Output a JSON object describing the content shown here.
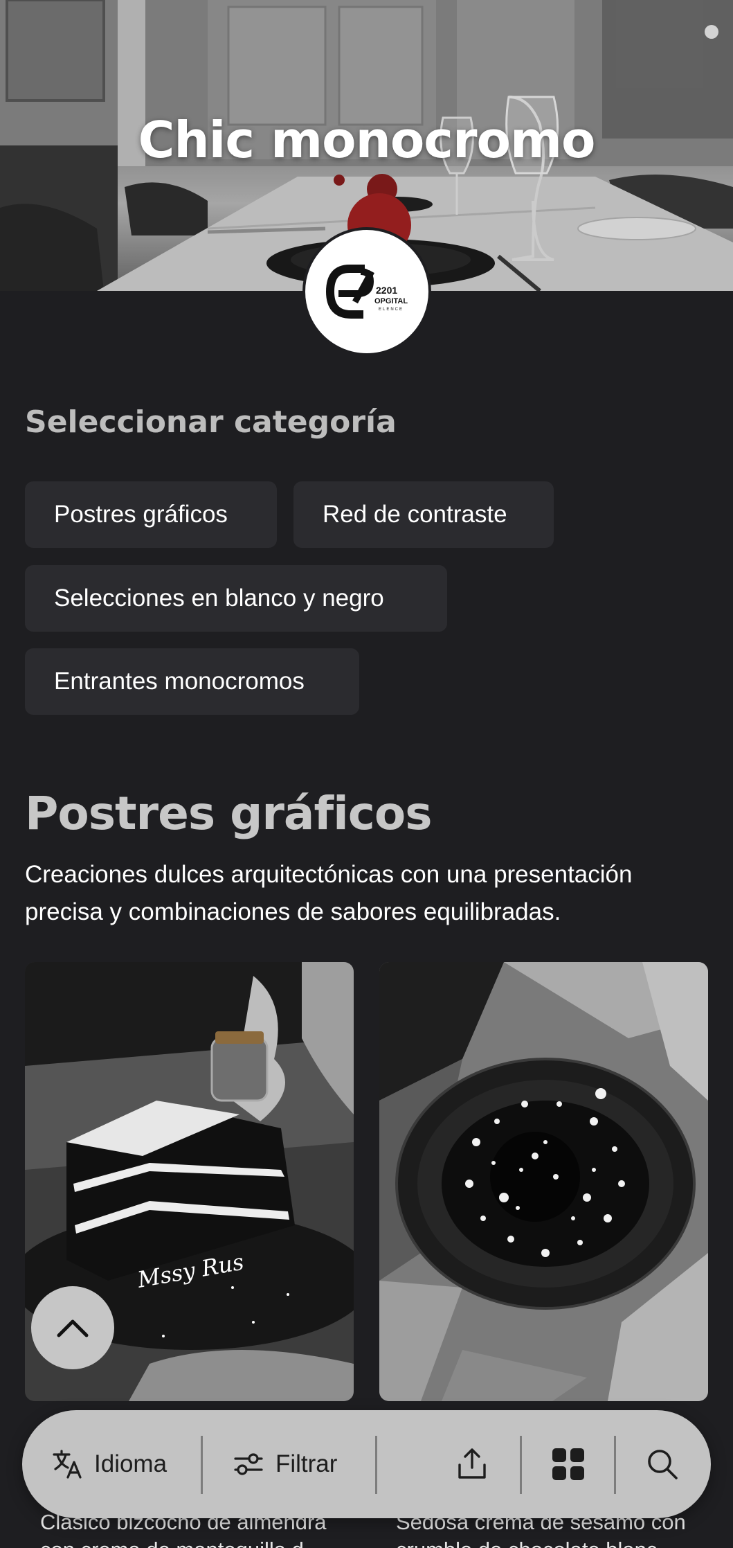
{
  "hero": {
    "title": "Chic monocromo",
    "logo_text": "2201 OPGITAL ELENCE"
  },
  "categories": {
    "label": "Seleccionar categoría",
    "items": [
      "Postres gráficos",
      "Red de contraste",
      "Selecciones en blanco y negro",
      "Entrantes monocromos"
    ]
  },
  "section": {
    "title": "Postres gráficos",
    "description": "Creaciones dulces arquitectónicas con una presentación precisa y combinaciones de sabores equilibradas."
  },
  "products": [
    {
      "desc_line1": "Clásico bizcocho de almendra",
      "desc_line2": "con crema de mantequilla d",
      "image_alt": "black layer cake"
    },
    {
      "desc_line1": "Sedosa crema de sésamo con",
      "desc_line2": "crumble de chocolate blanc",
      "image_alt": "black dome dessert"
    }
  ],
  "toolbar": {
    "language_label": "Idioma",
    "filter_label": "Filtrar",
    "icons": [
      "translate-icon",
      "filter-icon",
      "share-icon",
      "grid-icon",
      "search-icon"
    ]
  },
  "colors": {
    "background": "#1e1e21",
    "chip": "#2b2b2f",
    "toolbar": "#c3c3c3"
  }
}
